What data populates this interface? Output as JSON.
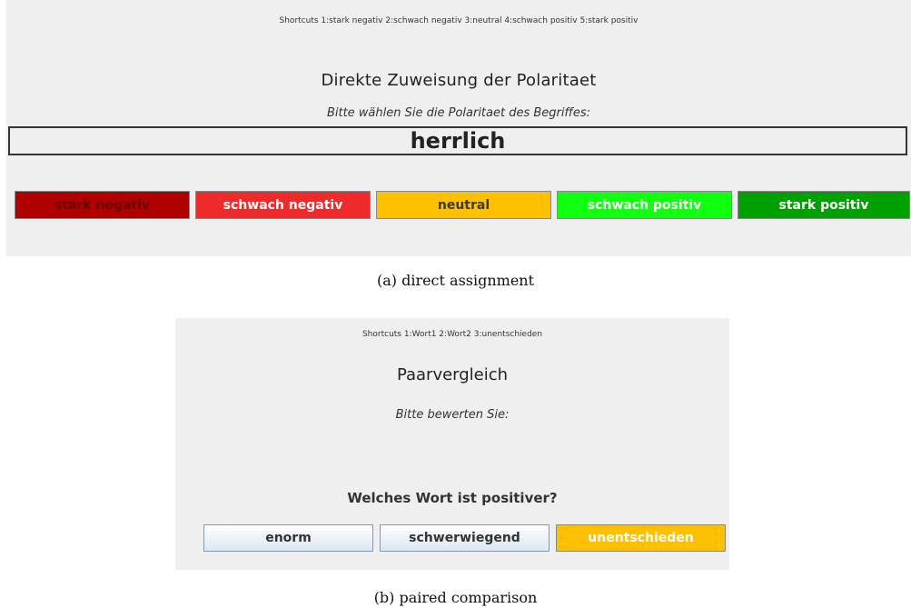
{
  "direct_assignment": {
    "shortcuts": "Shortcuts 1:stark negativ 2:schwach negativ 3:neutral 4:schwach positiv 5:stark positiv",
    "title": "Direkte Zuweisung der Polaritaet",
    "subtitle": "Bitte wählen Sie die Polaritaet des Begriffes:",
    "word": "herrlich",
    "buttons": [
      {
        "label": "stark negativ",
        "color": "#b00000"
      },
      {
        "label": "schwach negativ",
        "color": "#ef2a2a"
      },
      {
        "label": "neutral",
        "color": "#ffc000"
      },
      {
        "label": "schwach positiv",
        "color": "#11ff11"
      },
      {
        "label": "stark positiv",
        "color": "#00a000"
      }
    ],
    "caption": "(a)  direct assignment"
  },
  "paired_comparison": {
    "shortcuts": "Shortcuts 1:Wort1 2:Wort2 3:unentschieden",
    "title": "Paarvergleich",
    "subtitle": "Bitte bewerten Sie:",
    "question": "Welches Wort ist positiver?",
    "buttons": [
      {
        "label": "enorm"
      },
      {
        "label": "schwerwiegend"
      },
      {
        "label": "unentschieden",
        "color": "#ffc000"
      }
    ],
    "caption": "(b)  paired comparison"
  }
}
